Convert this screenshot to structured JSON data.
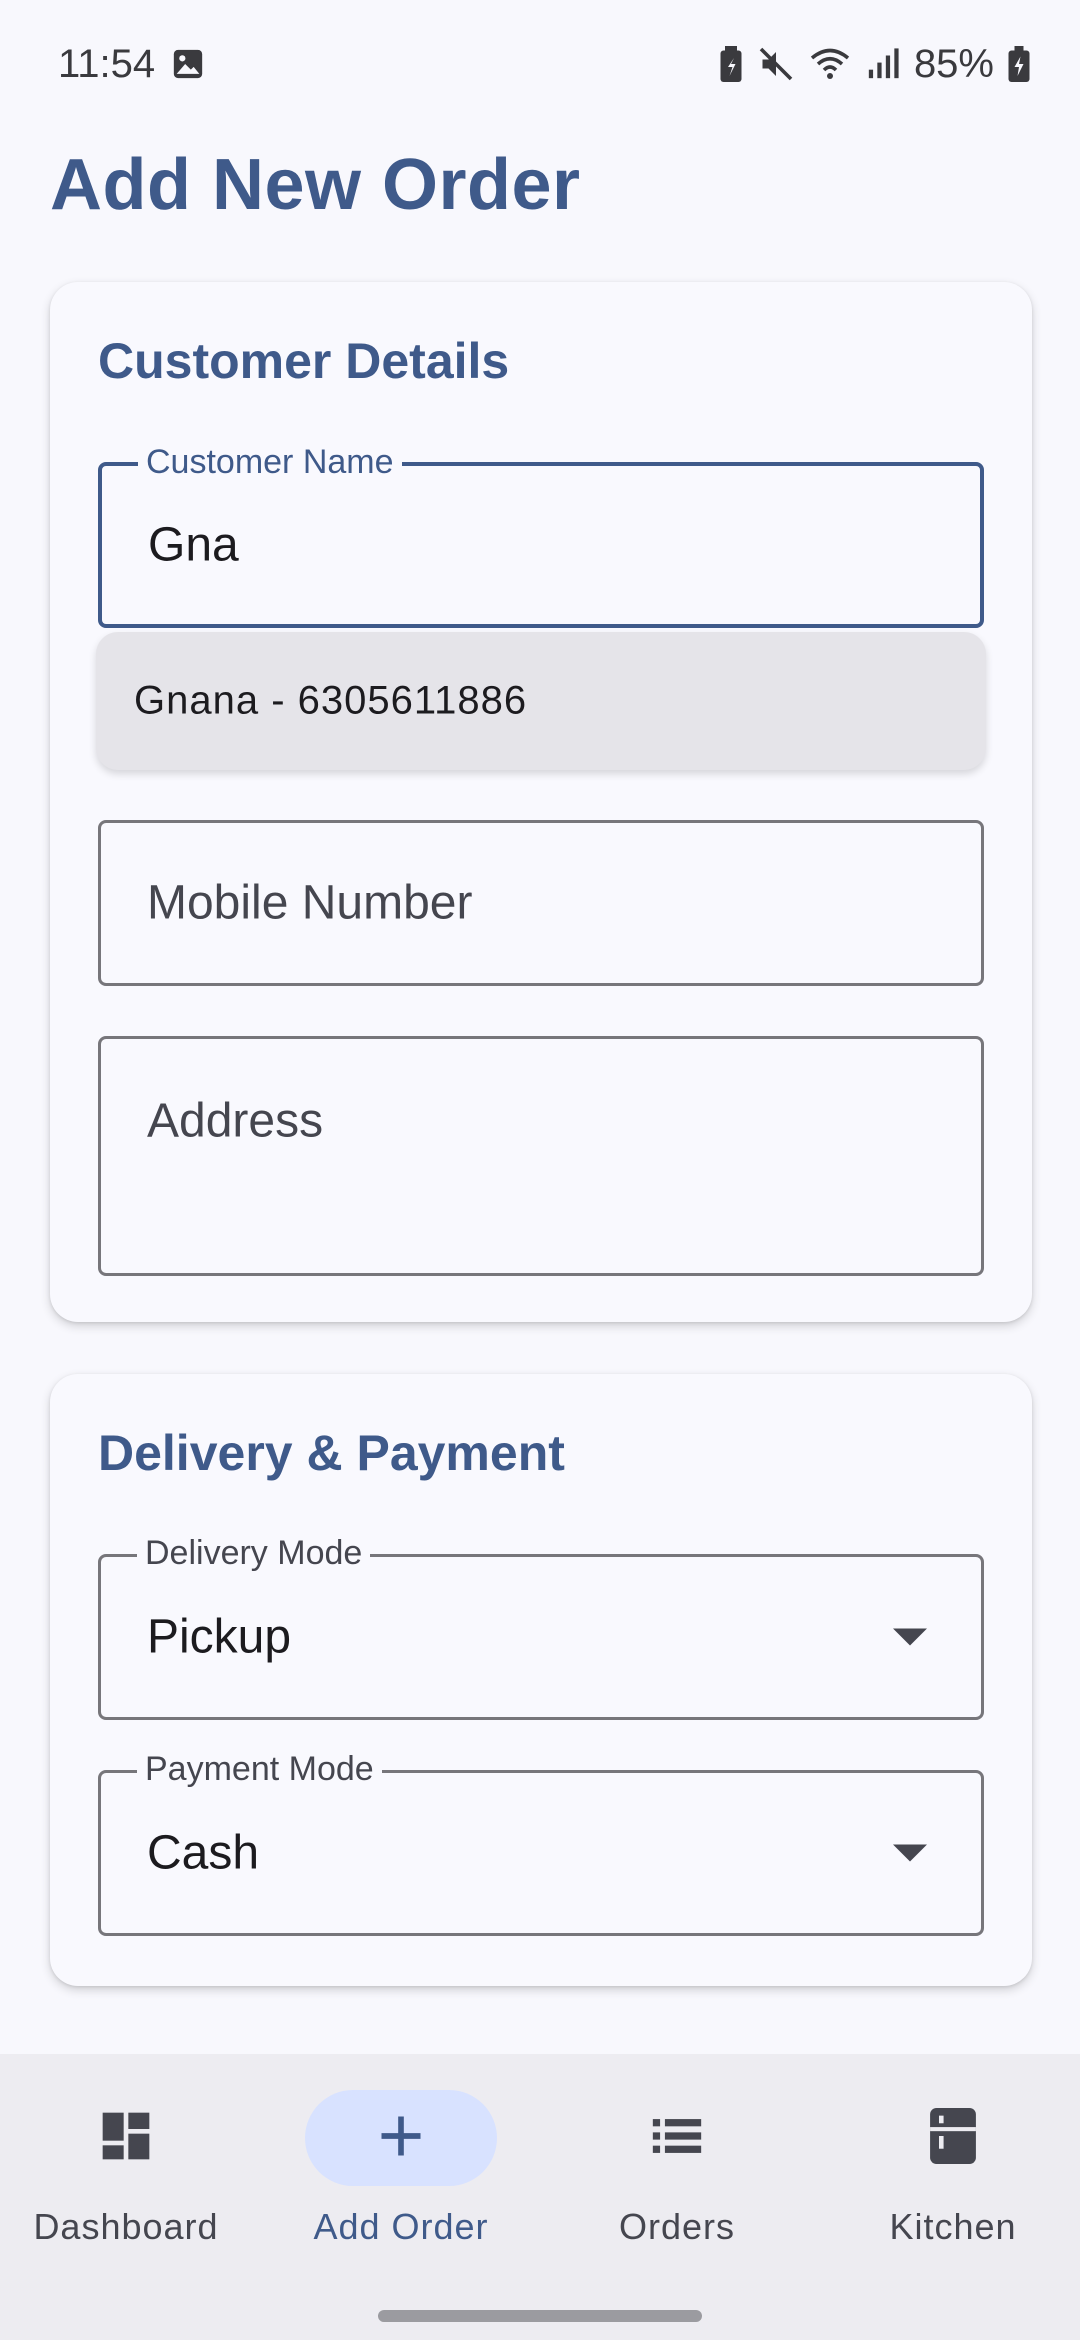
{
  "status_bar": {
    "time": "11:54",
    "battery": "85%",
    "icons": [
      "image-icon",
      "battery-saver-icon",
      "mute-icon",
      "wifi-icon",
      "signal-icon",
      "battery-charging-icon"
    ]
  },
  "page": {
    "title": "Add New Order"
  },
  "customer_details": {
    "title": "Customer Details",
    "name_field": {
      "label": "Customer Name",
      "value": "Gna"
    },
    "suggestion": "Gnana - 6305611886",
    "mobile_field": {
      "placeholder": "Mobile Number"
    },
    "address_field": {
      "placeholder": "Address"
    }
  },
  "delivery_payment": {
    "title": "Delivery & Payment",
    "delivery_mode": {
      "label": "Delivery Mode",
      "value": "Pickup"
    },
    "payment_mode": {
      "label": "Payment Mode",
      "value": "Cash"
    }
  },
  "bottom_nav": {
    "items": [
      {
        "label": "Dashboard",
        "icon": "dashboard-icon",
        "active": false
      },
      {
        "label": "Add Order",
        "icon": "add-icon",
        "active": true
      },
      {
        "label": "Orders",
        "icon": "list-icon",
        "active": false
      },
      {
        "label": "Kitchen",
        "icon": "kitchen-icon",
        "active": false
      }
    ]
  },
  "colors": {
    "accent": "#3f5a8a",
    "background": "#f8f8fd",
    "active_indicator": "#d8e2ff",
    "nav_background": "#edecf1"
  }
}
